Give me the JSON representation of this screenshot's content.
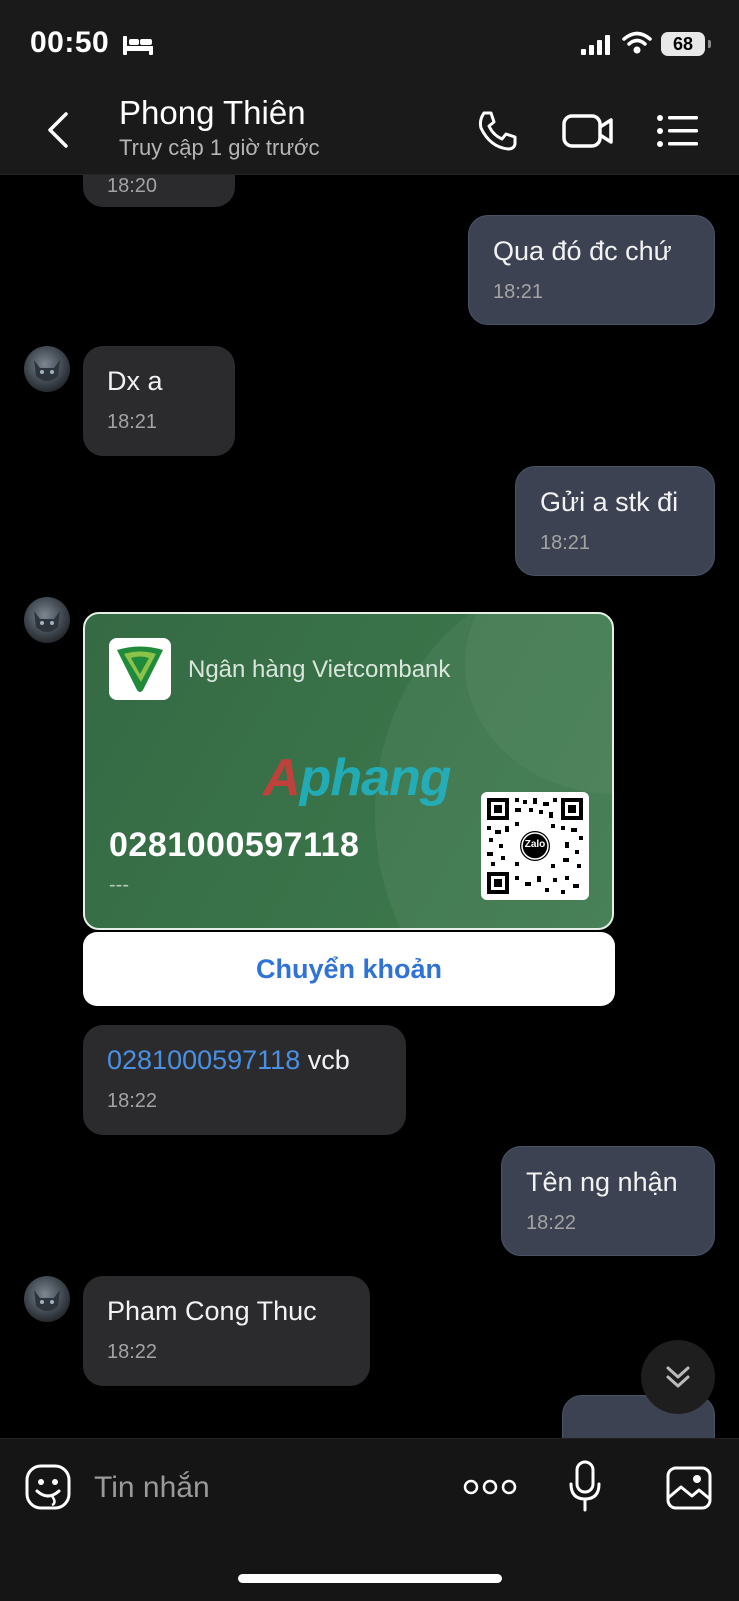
{
  "status_bar": {
    "time": "00:50",
    "battery": "68"
  },
  "header": {
    "name": "Phong Thiên",
    "status": "Truy cập 1 giờ trước"
  },
  "messages": [
    {
      "time": "18:20"
    },
    {
      "text": "Qua đó đc chứ",
      "time": "18:21"
    },
    {
      "text": "Dx a",
      "time": "18:21"
    },
    {
      "text": "Gửi a stk đi",
      "time": "18:21"
    },
    {
      "link": "0281000597118",
      "text": " vcb",
      "time": "18:22"
    },
    {
      "text": "Tên ng nhận",
      "time": "18:22"
    },
    {
      "text": "Pham Cong Thuc",
      "time": "18:22"
    }
  ],
  "bank_card": {
    "bank_name": "Ngân hàng Vietcombank",
    "watermark": "Aphang",
    "account_number": "0281000597118",
    "account_holder": "---",
    "qr_badge": "Zalo",
    "transfer_label": "Chuyển khoản"
  },
  "input": {
    "placeholder": "Tin nhắn"
  }
}
